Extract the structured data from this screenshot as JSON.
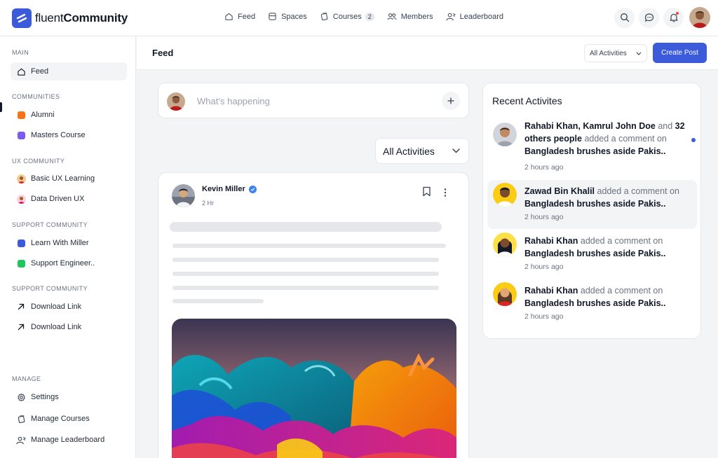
{
  "brand": {
    "name_light": "fluent",
    "name_bold": "Community",
    "color": "#3b5bdb"
  },
  "topnav": [
    {
      "label": "Feed",
      "icon": "home-icon"
    },
    {
      "label": "Spaces",
      "icon": "spaces-icon"
    },
    {
      "label": "Courses",
      "icon": "courses-icon",
      "badge": "2"
    },
    {
      "label": "Members",
      "icon": "members-icon"
    },
    {
      "label": "Leaderboard",
      "icon": "leaderboard-icon"
    }
  ],
  "sidebar": {
    "sections": [
      {
        "title": "MAIN"
      },
      {
        "title": "COMMUNITIES"
      },
      {
        "title": "UX COMMUNITY"
      },
      {
        "title": "SUPPORT COMMUNITY"
      },
      {
        "title": "SUPPORT COMMUNITY"
      },
      {
        "title": "MANAGE"
      }
    ],
    "items": [
      {
        "label": "Feed",
        "icon": "home-icon"
      },
      {
        "label": "Alumni",
        "icon": "square-orange",
        "color": "#f97316"
      },
      {
        "label": "Masters Course",
        "icon": "square-purple",
        "color": "#7c5cf0"
      },
      {
        "label": "Basic UX Learning",
        "icon": "avatar-icon"
      },
      {
        "label": "Data Driven UX",
        "icon": "avatar-icon"
      },
      {
        "label": "Learn With Miller",
        "icon": "square-blue",
        "color": "#3b5bdb"
      },
      {
        "label": "Support Engineer..",
        "icon": "square-green",
        "color": "#22c55e"
      },
      {
        "label": "Download Link",
        "icon": "arrow-up-right-icon"
      },
      {
        "label": "Download Link",
        "icon": "arrow-up-right-icon"
      },
      {
        "label": "Settings",
        "icon": "gear-icon"
      },
      {
        "label": "Manage Courses",
        "icon": "courses-icon"
      },
      {
        "label": "Manage Leaderboard",
        "icon": "leaderboard-icon"
      }
    ]
  },
  "header": {
    "title": "Feed",
    "filter_value": "All Activities",
    "create_label": "Create Post"
  },
  "composer": {
    "placeholder": "What’s happening"
  },
  "activities_dropdown": {
    "value": "All Activities"
  },
  "post": {
    "author": "Kevin Miller",
    "time": "2 Hr"
  },
  "recent": {
    "title": "Recent Activites",
    "items": [
      {
        "names": "Rahabi Khan, Kamrul John Doe",
        "connector": " and ",
        "others": "32 others people",
        "action": " added a comment on ",
        "target": "Bangladesh brushes aside Pakis..",
        "time": "2 hours ago",
        "unread": true
      },
      {
        "names": "Zawad Bin Khalil",
        "action": " added a comment on ",
        "target": "Bangladesh brushes aside Pakis..",
        "time": "2 hours ago"
      },
      {
        "names": "Rahabi Khan",
        "action": " added a comment on ",
        "target": "Bangladesh brushes aside Pakis..",
        "time": "2 hours ago"
      },
      {
        "names": "Rahabi Khan",
        "action": " added a comment on ",
        "target": "Bangladesh brushes aside Pakis..",
        "time": "2 hours ago"
      }
    ]
  }
}
